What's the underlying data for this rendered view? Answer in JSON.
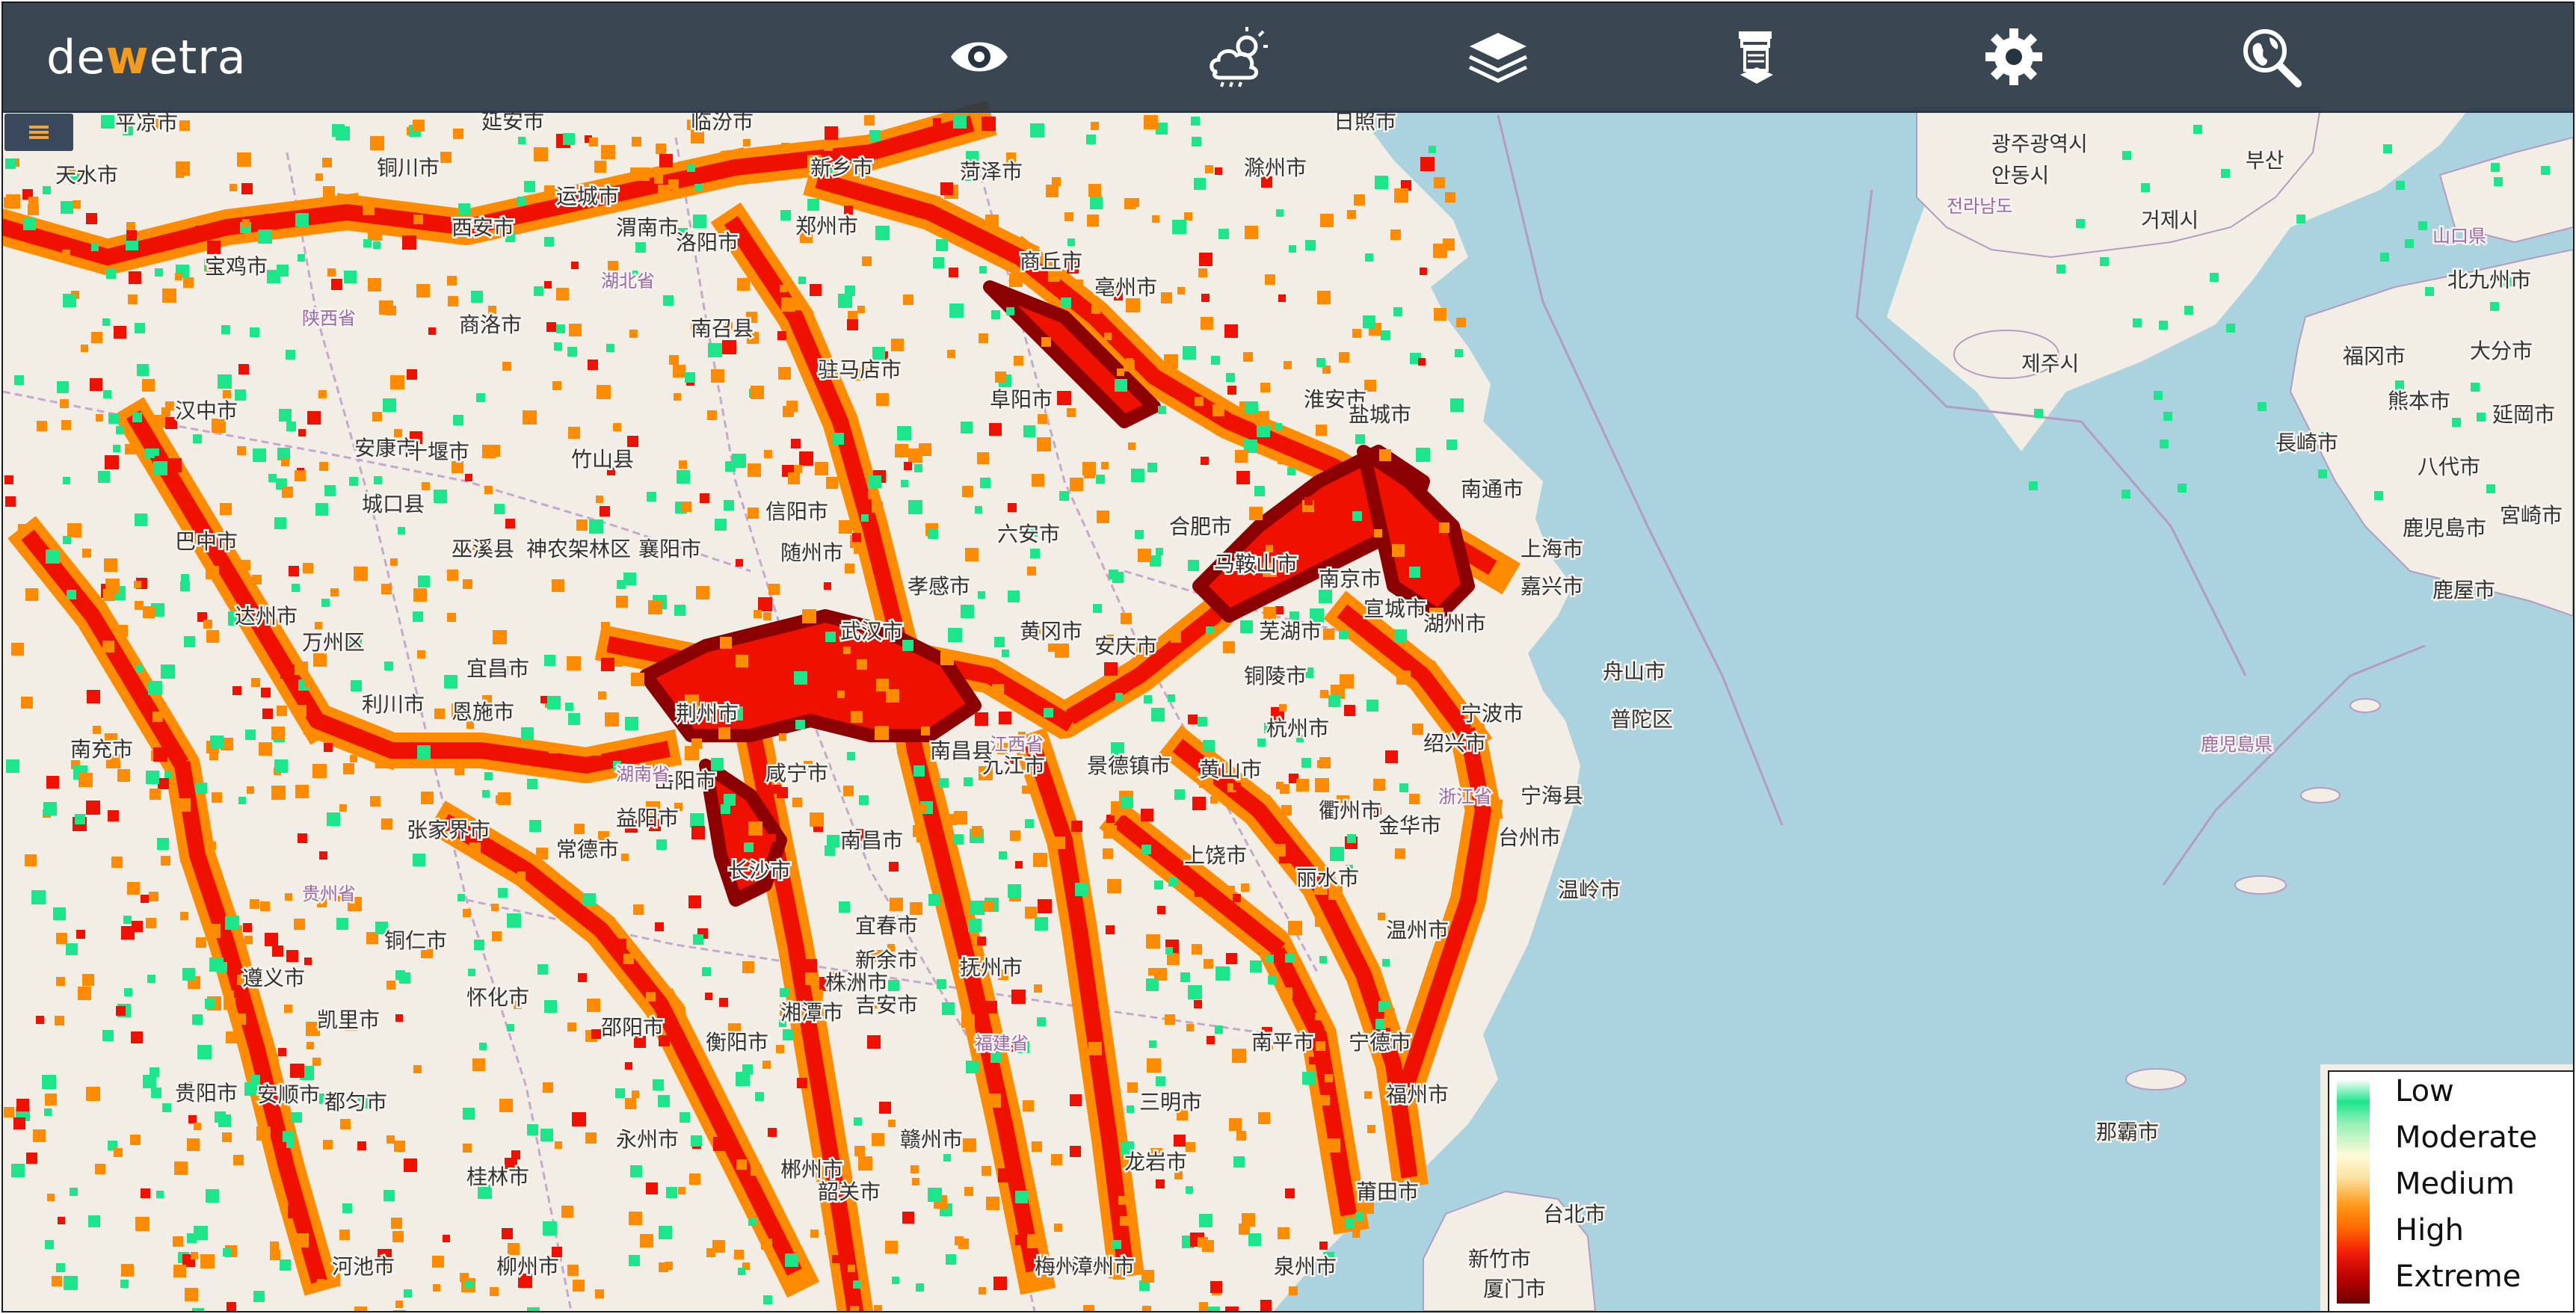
{
  "header": {
    "logo_prefix": "de",
    "logo_accent": "w",
    "logo_suffix": "etra",
    "tools": [
      {
        "icon": "eye-icon"
      },
      {
        "icon": "weather-cloud-sun-icon"
      },
      {
        "icon": "layers-icon"
      },
      {
        "icon": "document-stack-icon"
      },
      {
        "icon": "gear-icon"
      },
      {
        "icon": "globe-search-icon"
      }
    ]
  },
  "menu": {
    "icon": "hamburger-menu-icon"
  },
  "legend": {
    "items": [
      "Low",
      "Moderate",
      "Medium",
      "High",
      "Extreme"
    ],
    "colors": [
      "#1de58a",
      "#fffbd8",
      "#ff9a1a",
      "#ef1a0a",
      "#6b0000"
    ]
  },
  "map": {
    "colors": {
      "land": "#f3eee5",
      "sea": "#aad3df",
      "low": "#1de58a",
      "medium": "#ff8c00",
      "high": "#ee1100",
      "extreme": "#8b0000"
    },
    "labels": [
      "平凉市",
      "延安市",
      "临汾市",
      "新乡市",
      "菏泽市",
      "滁州市",
      "日照市",
      "광주광역시",
      "부산",
      "天水市",
      "铜川市",
      "运城市",
      "郑州市",
      "商丘市",
      "宝鸡市",
      "西安市",
      "渭南市",
      "洛阳市",
      "亳州市",
      "商洛市",
      "南召县",
      "汉中市",
      "安康市",
      "驻马店市",
      "阜阳市",
      "淮安市",
      "盐城市",
      "南通市",
      "十堰市",
      "竹山县",
      "信阳市",
      "六安市",
      "合肥市",
      "马鞍山市",
      "南京市",
      "巴中市",
      "城口县",
      "巫溪县",
      "神农架林区",
      "襄阳市",
      "随州市",
      "孝感市",
      "武汉市",
      "黄冈市",
      "安庆市",
      "铜陵市",
      "芜湖市",
      "宣城市",
      "湖州市",
      "嘉兴市",
      "上海市",
      "达州市",
      "万州区",
      "利川市",
      "恩施市",
      "宜昌市",
      "荆州市",
      "咸宁市",
      "九江市",
      "景德镇市",
      "黄山市",
      "杭州市",
      "绍兴市",
      "宁波市",
      "舟山市",
      "普陀区",
      "南充市",
      "张家界市",
      "常德市",
      "益阳市",
      "长沙市",
      "岳阳市",
      "南昌市",
      "上饶市",
      "衢州市",
      "金华市",
      "台州市",
      "温岭市",
      "遵义市",
      "铜仁市",
      "怀化市",
      "邵阳市",
      "衡阳市",
      "宜春市",
      "新余市",
      "吉安市",
      "抚州市",
      "丽水市",
      "温州市",
      "贵阳市",
      "凯里市",
      "株洲市",
      "湘潭市",
      "永州市",
      "郴州市",
      "赣州市",
      "南平市",
      "宁德市",
      "福州市",
      "安顺市",
      "都匀市",
      "桂林市",
      "韶关市",
      "三明市",
      "龙岩市",
      "莆田市",
      "泉州市",
      "河池市",
      "柳州市",
      "梅州市",
      "漳州市",
      "厦门市",
      "台北市",
      "新竹市",
      "那霸市",
      "제주시",
      "北九州市",
      "福冈市",
      "熊本市",
      "大分市",
      "長崎市",
      "延岡市",
      "鹿児島市",
      "宮崎市",
      "鹿屋市",
      "八代市",
      "陕西省",
      "湖北省",
      "湖南省",
      "江西省",
      "浙江省",
      "贵州省",
      "福建省",
      "안동시",
      "거제시",
      "전라남도",
      "山口県",
      "鹿児島県",
      "宁海县",
      "南昌县"
    ]
  }
}
